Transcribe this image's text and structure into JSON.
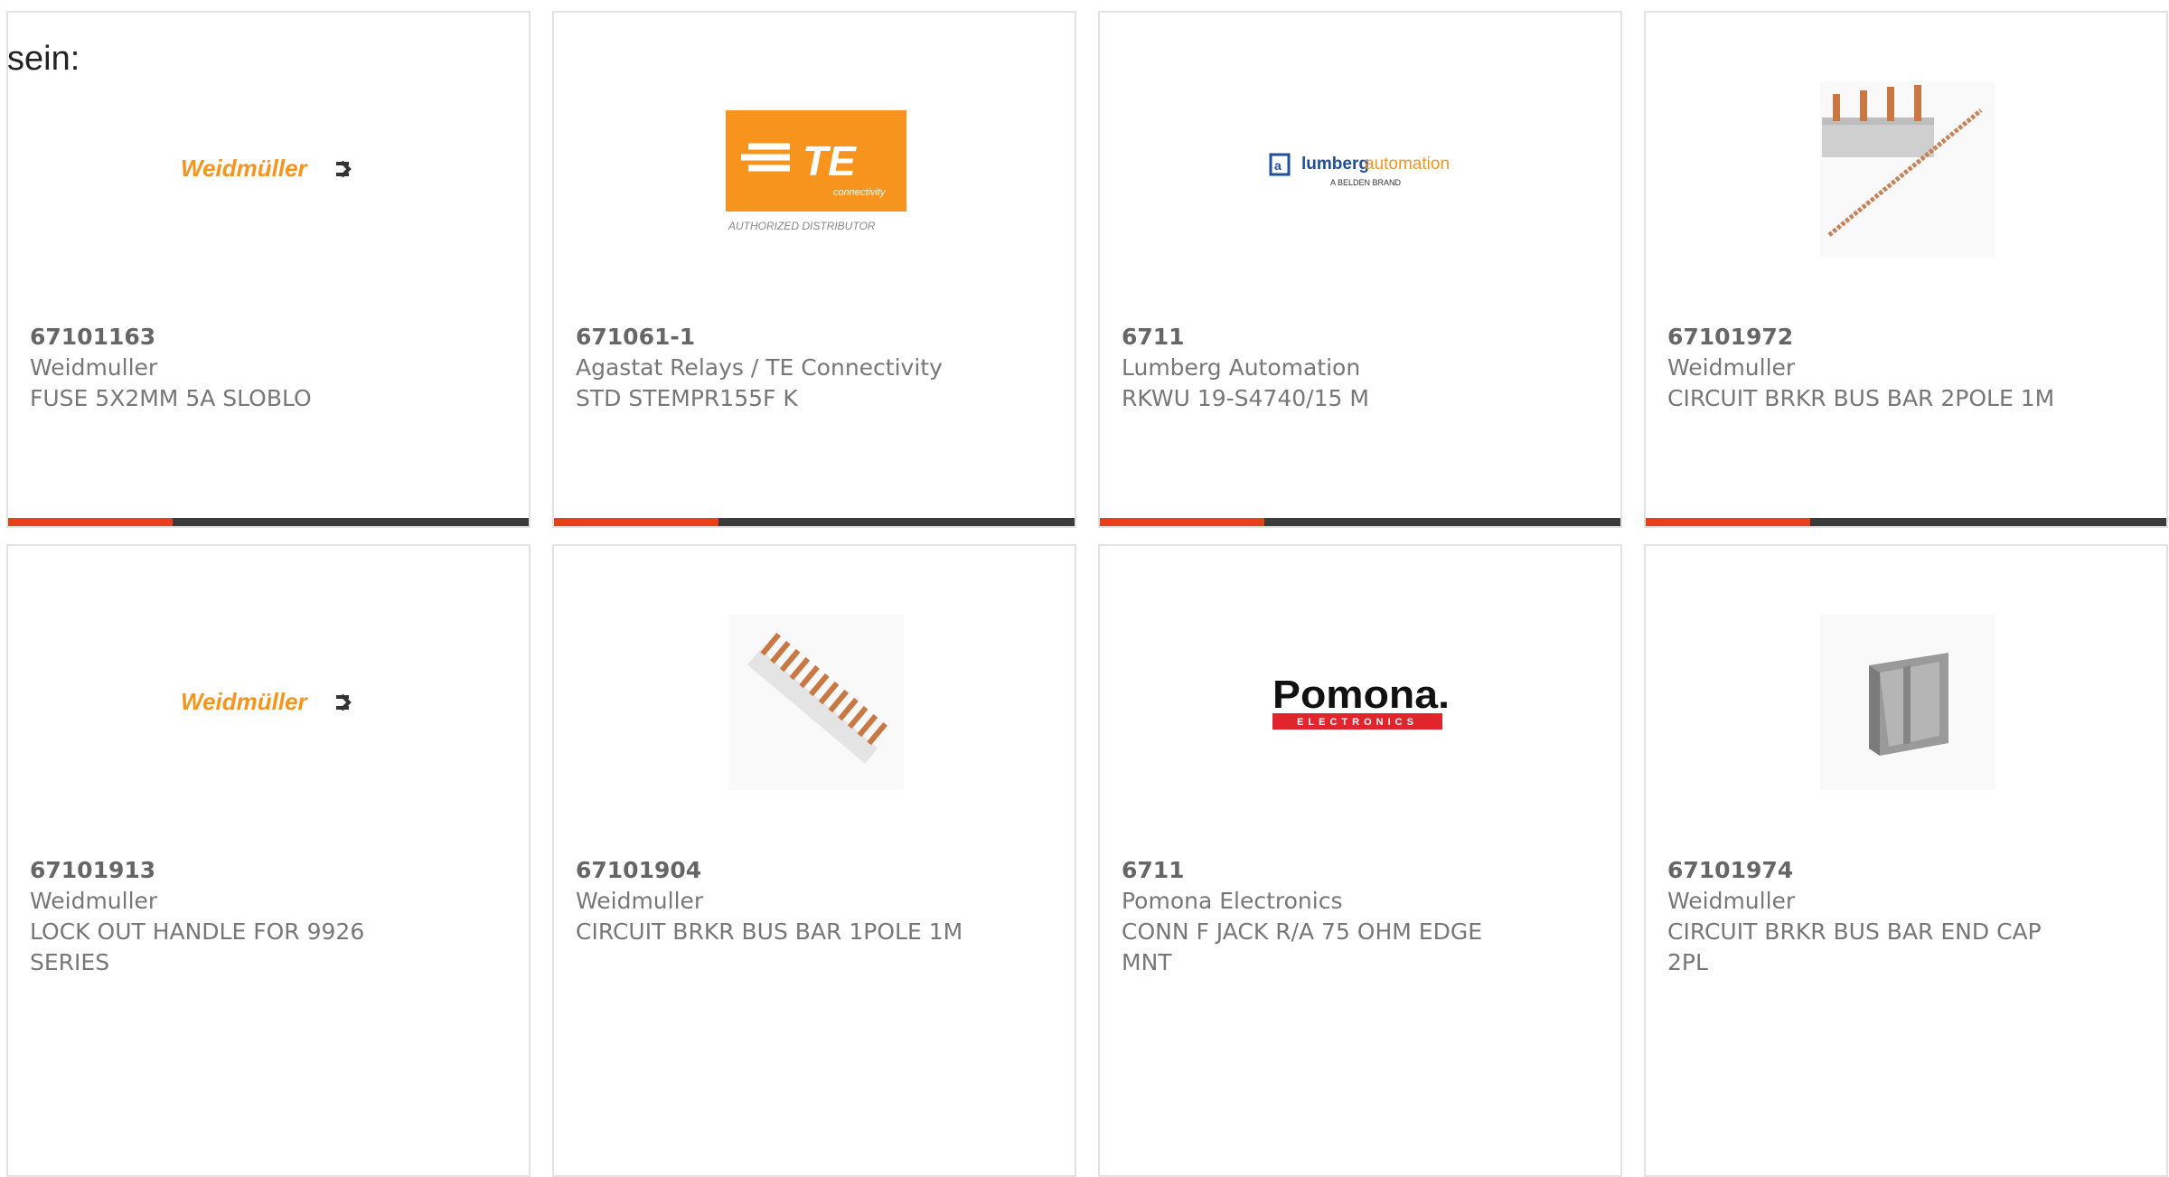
{
  "intro_text": "sein:",
  "accent_color": "#e8411a",
  "bar_color": "#3b3b3b",
  "logos": {
    "weidmuller": "Weidmüller",
    "te_mark": "TE",
    "te_sub": "connectivity",
    "te_distributor": "AUTHORIZED DISTRIBUTOR",
    "lumberg_a": "lumberg",
    "lumberg_b": "automation",
    "lumberg_brand": "A BELDEN BRAND",
    "pomona": "Pomona.",
    "pomona_sub": "ELECTRONICS"
  },
  "products": [
    {
      "part": "67101163",
      "manufacturer": "Weidmuller",
      "description": "FUSE 5X2MM 5A SLOBLO",
      "image": "weidmuller-logo"
    },
    {
      "part": "671061-1",
      "manufacturer": "Agastat Relays / TE Connectivity",
      "description": "STD STEMPR155F K",
      "image": "te-connectivity-logo"
    },
    {
      "part": "6711",
      "manufacturer": "Lumberg Automation",
      "description": "RKWU 19-S4740/15 M",
      "image": "lumberg-logo"
    },
    {
      "part": "67101972",
      "manufacturer": "Weidmuller",
      "description": "CIRCUIT BRKR BUS BAR 2POLE 1M",
      "image": "busbar-2pole"
    },
    {
      "part": "67101913",
      "manufacturer": "Weidmuller",
      "description": "LOCK OUT HANDLE FOR 9926 SERIES",
      "image": "weidmuller-logo"
    },
    {
      "part": "67101904",
      "manufacturer": "Weidmuller",
      "description": "CIRCUIT BRKR BUS BAR 1POLE 1M",
      "image": "busbar-1pole"
    },
    {
      "part": "6711",
      "manufacturer": "Pomona Electronics",
      "description": "CONN F JACK R/A 75 OHM EDGE MNT",
      "image": "pomona-logo"
    },
    {
      "part": "67101974",
      "manufacturer": "Weidmuller",
      "description": "CIRCUIT BRKR BUS BAR END CAP 2PL",
      "image": "end-cap"
    }
  ]
}
